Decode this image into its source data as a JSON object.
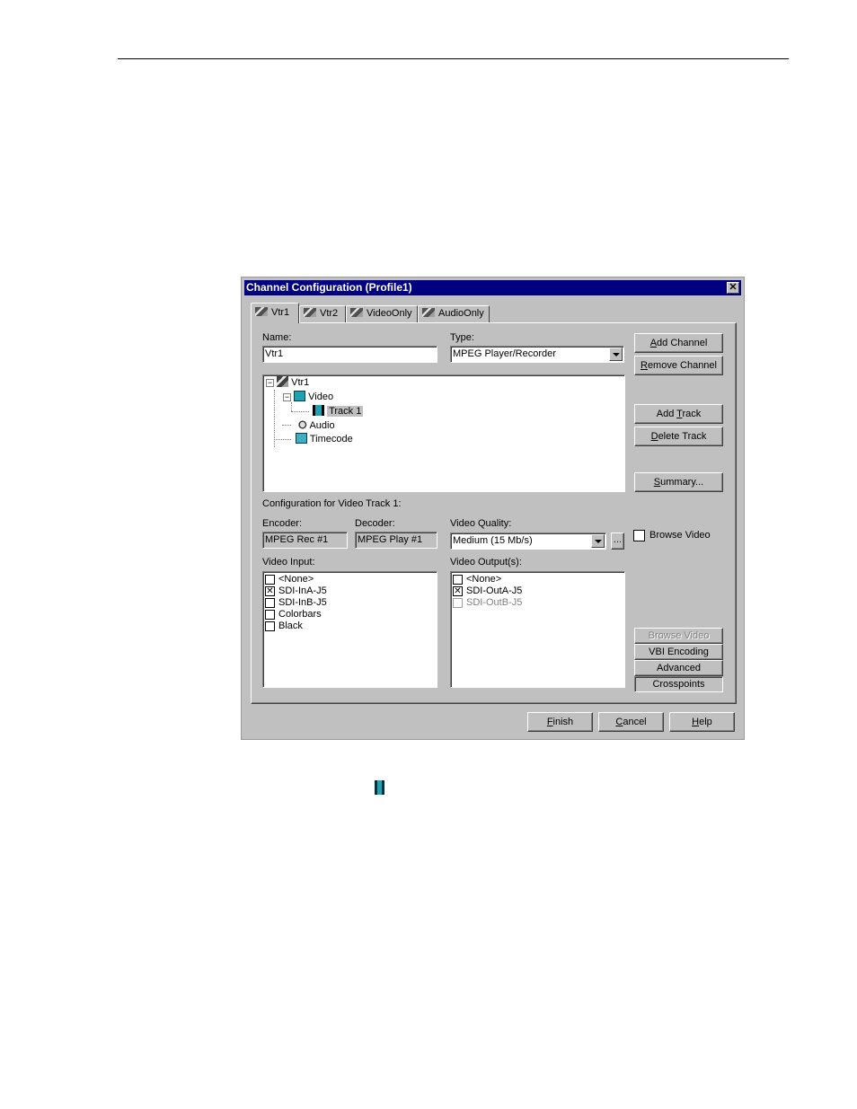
{
  "dialog": {
    "title": "Channel Configuration (Profile1)",
    "close_glyph": "✕",
    "tabs": [
      {
        "label": "Vtr1",
        "active": true
      },
      {
        "label": "Vtr2",
        "active": false
      },
      {
        "label": "VideoOnly",
        "active": false
      },
      {
        "label": "AudioOnly",
        "active": false
      }
    ],
    "name_label": "Name:",
    "name_value": "Vtr1",
    "type_label": "Type:",
    "type_value": "MPEG Player/Recorder",
    "tree": {
      "root": "Vtr1",
      "video": "Video",
      "track": "Track 1",
      "audio": "Audio",
      "timecode": "Timecode"
    },
    "side_buttons": {
      "add_channel": {
        "pre": "",
        "key": "A",
        "post": "dd Channel"
      },
      "remove_channel": {
        "pre": "",
        "key": "R",
        "post": "emove Channel"
      },
      "add_track": {
        "pre": "Add ",
        "key": "T",
        "post": "rack"
      },
      "delete_track": {
        "pre": "",
        "key": "D",
        "post": "elete Track"
      },
      "summary": {
        "pre": "",
        "key": "S",
        "post": "ummary..."
      }
    },
    "config_heading": "Configuration for Video Track 1:",
    "encoder_label": "Encoder:",
    "encoder_value": "MPEG Rec #1",
    "decoder_label": "Decoder:",
    "decoder_value": "MPEG Play #1",
    "quality_label": "Video Quality:",
    "quality_value": "Medium (15 Mb/s)",
    "quality_more": "...",
    "browse_check_label": "Browse Video",
    "video_input_label": "Video Input:",
    "video_inputs": [
      {
        "label": "<None>",
        "checked": false,
        "enabled": true
      },
      {
        "label": "SDI-InA-J5",
        "checked": true,
        "enabled": true
      },
      {
        "label": "SDI-InB-J5",
        "checked": false,
        "enabled": true
      },
      {
        "label": "Colorbars",
        "checked": false,
        "enabled": true
      },
      {
        "label": "Black",
        "checked": false,
        "enabled": true
      }
    ],
    "video_output_label": "Video Output(s):",
    "video_outputs": [
      {
        "label": "<None>",
        "checked": false,
        "enabled": true
      },
      {
        "label": "SDI-OutA-J5",
        "checked": true,
        "enabled": true
      },
      {
        "label": "SDI-OutB-J5",
        "checked": false,
        "enabled": false
      }
    ],
    "lower_buttons": {
      "browse_video": "Browse Video",
      "vbi_encoding": "VBI Encoding",
      "advanced": "Advanced",
      "crosspoints": "Crosspoints"
    },
    "footer_buttons": {
      "finish": {
        "key": "F",
        "post": "inish"
      },
      "cancel": {
        "key": "C",
        "post": "ancel"
      },
      "help": {
        "key": "H",
        "post": "elp"
      }
    }
  }
}
